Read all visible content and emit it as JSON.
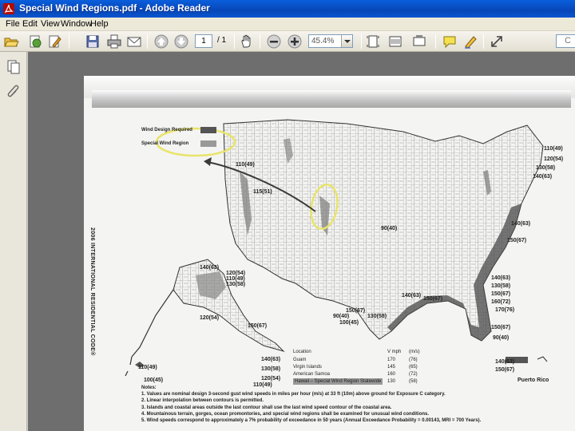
{
  "window": {
    "title": "Special Wind Regions.pdf - Adobe Reader"
  },
  "menu": [
    "File",
    "Edit",
    "View",
    "Window",
    "Help"
  ],
  "toolbar": {
    "page_current": "1",
    "page_total": "/ 1",
    "zoom_value": "45.4%",
    "search_text": "C"
  },
  "document": {
    "side_title": "2006 INTERNATIONAL RESIDENTIAL CODE®",
    "legend": {
      "design_required": "Wind Design Required",
      "special_region": "Special Wind Region"
    },
    "wind_labels": [
      "110(49)",
      "115(51)",
      "110(49)",
      "120(54)",
      "130(58)",
      "140(63)",
      "90(40)",
      "140(63)",
      "150(67)",
      "140(63)",
      "130(58)",
      "150(67)",
      "140(63)",
      "120(54)",
      "110(49)",
      "130(58)",
      "140(63)",
      "150(67)",
      "160(72)",
      "170(76)",
      "150(67)",
      "90(40)",
      "100(45)",
      "130(58)",
      "150(67)",
      "90(40)",
      "150(67)",
      "140(63)",
      "130(58)",
      "120(54)",
      "110(49)",
      "110(49)",
      "100(45)",
      "120(54)",
      "140(63)",
      "150(67)"
    ],
    "table": {
      "headers": [
        "Location",
        "V mph",
        "(m/s)"
      ],
      "rows": [
        [
          "Guam",
          "170",
          "(76)"
        ],
        [
          "Virgin Islands",
          "145",
          "(65)"
        ],
        [
          "American Samoa",
          "160",
          "(72)"
        ],
        [
          "Hawaii – Special Wind Region Statewide",
          "130",
          "(58)"
        ]
      ]
    },
    "puerto_rico": "Puerto Rico",
    "notes": [
      "Notes:",
      "1. Values are nominal design 3-second gust wind speeds in miles per hour (m/s) at 33 ft (10m) above ground for Exposure C category.",
      "2. Linear interpolation between contours is permitted.",
      "3. Islands and coastal areas outside the last contour shall use the last wind speed contour of the coastal area.",
      "4. Mountainous terrain, gorges, ocean promontories, and special wind regions shall be examined for unusual wind conditions.",
      "5. Wind speeds correspond to approximately a 7% probability of exceedance in 50 years (Annual Exceedance Probability = 0.00143, MRI = 700 Years)."
    ]
  },
  "icons": {
    "app": "adobe-reader-icon",
    "open": "open-folder-icon",
    "create": "create-pdf-icon",
    "edit": "edit-pdf-icon",
    "save": "save-icon",
    "print": "print-icon",
    "email": "email-icon",
    "prev": "previous-page-icon",
    "next": "next-page-icon",
    "hand": "hand-tool-icon",
    "zoom_out": "zoom-out-icon",
    "zoom_in": "zoom-in-icon",
    "fit_page": "fit-page-icon",
    "fit_width": "fit-width-icon",
    "comment": "comment-icon",
    "sign": "sign-icon",
    "expand": "expand-icon",
    "pages": "pages-panel-icon",
    "attachments": "attachments-panel-icon"
  },
  "colors": {
    "titlebar": "#0a55d0",
    "annotation_yellow": "#e8e46a",
    "arrow": "#3a3a3a"
  }
}
